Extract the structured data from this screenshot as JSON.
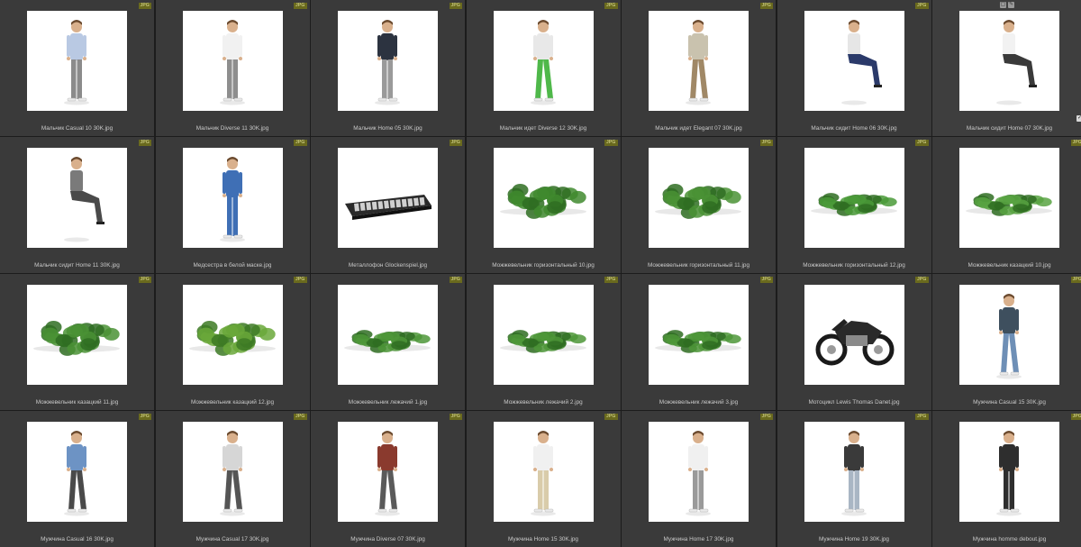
{
  "browser": {
    "badge_label": "JPG",
    "tool_icons": [
      "frame-icon",
      "pencil-icon"
    ],
    "check_glyph": "✓",
    "items": [
      {
        "caption": "Мальчик Casual 10 30K.jpg",
        "icon": "person-boy-icon",
        "shirt": "#b9c9e3",
        "pants": "#8b8b8b",
        "pose": "stand"
      },
      {
        "caption": "Мальчик Diverse 11 30K.jpg",
        "icon": "person-boy-icon",
        "shirt": "#f1f1f1",
        "pants": "#8e8e8e",
        "pose": "stand"
      },
      {
        "caption": "Мальчик Home 05 30K.jpg",
        "icon": "person-boy-icon",
        "shirt": "#2c3340",
        "pants": "#9a9a9a",
        "pose": "stand"
      },
      {
        "caption": "Мальчик идет Diverse 12 30K.jpg",
        "icon": "person-boy-icon",
        "shirt": "#e8e8e8",
        "pants": "#4fb84a",
        "pose": "walk"
      },
      {
        "caption": "Мальчик идет Elegant 07 30K.jpg",
        "icon": "person-boy-icon",
        "shirt": "#c9c2ae",
        "pants": "#a08866",
        "pose": "walk"
      },
      {
        "caption": "Мальчик сидит Home 06 30K.jpg",
        "icon": "person-boy-icon",
        "shirt": "#e6e6e6",
        "pants": "#2b3a6a",
        "pose": "sit"
      },
      {
        "caption": "Мальчик сидит Home 07 30K.jpg",
        "icon": "person-boy-icon",
        "shirt": "#f2f2f2",
        "pants": "#3a3a3a",
        "pose": "sit"
      },
      {
        "caption": "Мальчик сидит Home 11 30K.jpg",
        "icon": "person-sitting-icon",
        "shirt": "#7a7a7a",
        "pants": "#4a4a4a",
        "pose": "sit"
      },
      {
        "caption": "Медсестра в белой маске.jpg",
        "icon": "nurse-icon",
        "shirt": "#3f6fb5",
        "pants": "#3f6fb5",
        "pose": "stand"
      },
      {
        "caption": "Металлофон Glockenspiel.jpg",
        "icon": "glockenspiel-icon",
        "shirt": "#2a2a2a",
        "pants": "#cccccc",
        "pose": "object"
      },
      {
        "caption": "Можжевельник горизонтальный 10.jpg",
        "icon": "shrub-icon",
        "shirt": "#3f8a2e",
        "pants": "#2f6d22",
        "pose": "shrub"
      },
      {
        "caption": "Можжевельник горизонтальный 11.jpg",
        "icon": "shrub-icon",
        "shirt": "#4a9235",
        "pants": "#2f6d22",
        "pose": "shrub"
      },
      {
        "caption": "Можжевельник горизонтальный 12.jpg",
        "icon": "shrub-icon",
        "shirt": "#4a9a38",
        "pants": "#2f6d22",
        "pose": "flat-shrub"
      },
      {
        "caption": "Можжевельник казацкий 10.jpg",
        "icon": "shrub-icon",
        "shirt": "#58a342",
        "pants": "#2f6d22",
        "pose": "flat-shrub"
      },
      {
        "caption": "Можжевельник казацкий 11.jpg",
        "icon": "shrub-icon",
        "shirt": "#4a9235",
        "pants": "#2f6d22",
        "pose": "shrub"
      },
      {
        "caption": "Можжевельник казацкий 12.jpg",
        "icon": "shrub-icon",
        "shirt": "#6aa83a",
        "pants": "#3d7a25",
        "pose": "shrub"
      },
      {
        "caption": "Можжевельник лежачий 1.jpg",
        "icon": "shrub-icon",
        "shirt": "#4d9738",
        "pants": "#2f6d22",
        "pose": "flat-shrub"
      },
      {
        "caption": "Можжевельник лежачий 2.jpg",
        "icon": "shrub-icon",
        "shirt": "#4d9738",
        "pants": "#2f6d22",
        "pose": "flat-shrub"
      },
      {
        "caption": "Можжевельник лежачий 3.jpg",
        "icon": "shrub-icon",
        "shirt": "#4d9738",
        "pants": "#2f6d22",
        "pose": "flat-shrub"
      },
      {
        "caption": "Мотоцикл Lewis Thomas Danet.jpg",
        "icon": "motorcycle-icon",
        "shirt": "#2a2a2a",
        "pants": "#8a8a8a",
        "pose": "moto"
      },
      {
        "caption": "Мужчина Casual 15 30K.jpg",
        "icon": "person-man-icon",
        "shirt": "#3e4f5e",
        "pants": "#6e8fb6",
        "pose": "walk"
      },
      {
        "caption": "Мужчина Casual 16 30K.jpg",
        "icon": "person-man-icon",
        "shirt": "#6d93c4",
        "pants": "#4a4a4a",
        "pose": "walk"
      },
      {
        "caption": "Мужчина Casual 17 30K.jpg",
        "icon": "person-man-icon",
        "shirt": "#d6d6d6",
        "pants": "#555555",
        "pose": "walk"
      },
      {
        "caption": "Мужчина Diverse 07 30K.jpg",
        "icon": "person-man-icon",
        "shirt": "#8a3a2e",
        "pants": "#5a5a5a",
        "pose": "walk"
      },
      {
        "caption": "Мужчина Home 15 30K.jpg",
        "icon": "person-man-icon",
        "shirt": "#f0f0f0",
        "pants": "#d9ccaa",
        "pose": "stand"
      },
      {
        "caption": "Мужчина Home 17 30K.jpg",
        "icon": "person-man-icon",
        "shirt": "#f0f0f0",
        "pants": "#9a9a9a",
        "pose": "stand"
      },
      {
        "caption": "Мужчина Home 19 30K.jpg",
        "icon": "person-man-icon",
        "shirt": "#3a3a3a",
        "pants": "#a9b6c4",
        "pose": "stand"
      },
      {
        "caption": "Мужчина homme debout.jpg",
        "icon": "person-man-icon",
        "shirt": "#2e2e2e",
        "pants": "#2e2e2e",
        "pose": "stand"
      }
    ]
  }
}
